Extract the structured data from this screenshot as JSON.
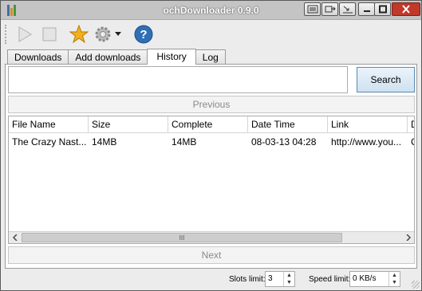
{
  "window": {
    "title": "ochDownloader 0.9.0"
  },
  "titlebar": {
    "buttons": [
      "captcha-icon",
      "clipboard-icon",
      "tray-icon",
      "minimize-icon",
      "maximize-icon",
      "close-icon"
    ]
  },
  "toolbar": {
    "tools": [
      "play-icon",
      "stop-icon",
      "star-icon",
      "gear-icon",
      "dropdown-arrow-icon",
      "help-icon"
    ]
  },
  "tabs": [
    "Downloads",
    "Add downloads",
    "History",
    "Log"
  ],
  "active_tab": "History",
  "search": {
    "value": "",
    "placeholder": "",
    "button_label": "Search"
  },
  "pager": {
    "previous_label": "Previous",
    "next_label": "Next"
  },
  "table": {
    "columns": [
      "File Name",
      "Size",
      "Complete",
      "Date Time",
      "Link",
      "D"
    ],
    "rows": [
      [
        "The Crazy Nast...",
        "14MB",
        "14MB",
        "08-03-13 04:28",
        "http://www.you...",
        "C"
      ]
    ],
    "scrollbar_grip": "III"
  },
  "status": {
    "slots_label": "Slots limit:",
    "slots_value": "3",
    "speed_label": "Speed limit:",
    "speed_value": "0 KB/s"
  },
  "colors": {
    "help_blue": "#2f6fb5",
    "star_gold": "#f2b01e",
    "close_red": "#c0392b",
    "search_border": "#5a8ab0"
  }
}
